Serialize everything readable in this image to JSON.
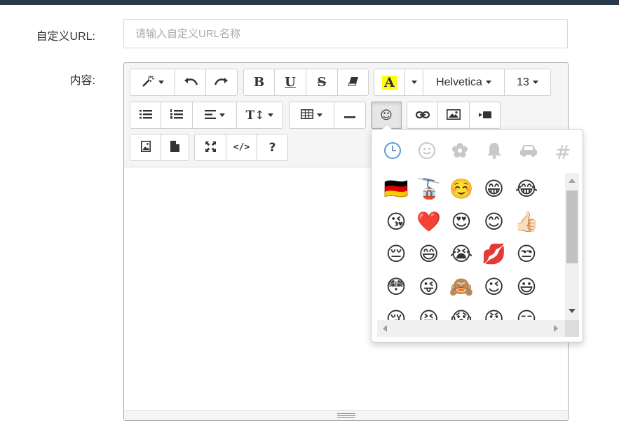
{
  "form": {
    "url_label": "自定义URL:",
    "url_placeholder": "请输入自定义URL名称",
    "url_value": "",
    "content_label": "内容:"
  },
  "toolbar": {
    "font_name": "Helvetica",
    "font_size": "13",
    "icons": [
      "magic-wand-icon",
      "undo-icon",
      "redo-icon",
      "bold-icon",
      "underline-icon",
      "strikethrough-icon",
      "eraser-icon",
      "font-color-icon",
      "color-dropdown-icon",
      "font-name-dropdown",
      "font-size-dropdown",
      "unordered-list-icon",
      "ordered-list-icon",
      "align-icon",
      "line-height-icon",
      "table-icon",
      "horizontal-rule-icon",
      "emoji-icon",
      "link-icon",
      "picture-icon",
      "video-icon",
      "image-upload-icon",
      "file-icon",
      "fullscreen-icon",
      "code-view-icon",
      "help-icon"
    ],
    "bold_glyph": "B",
    "underline_glyph": "U",
    "strike_glyph": "S",
    "help_glyph": "?",
    "code_glyph": "</>",
    "font_color_glyph": "A",
    "line_height_glyph": "T↕",
    "emoji_glyph": "☺"
  },
  "emoji_popup": {
    "categories": [
      "recent-clock-icon",
      "smiley-icon",
      "flower-icon",
      "bell-icon",
      "car-icon",
      "hash-icon"
    ],
    "active_category": "recent-clock-icon",
    "hash_glyph": "#",
    "rows": [
      [
        "🇩🇪",
        "🚡",
        "☺️",
        "😁",
        "😂"
      ],
      [
        "😘",
        "❤️",
        "😍",
        "😊",
        "👍🏻"
      ],
      [
        "😔",
        "😄",
        "😭",
        "💋",
        "😒"
      ],
      [
        "😳",
        "😜",
        "🙈",
        "😉",
        "😃"
      ],
      [
        "😢",
        "😝",
        "😱",
        "😡",
        "😏"
      ]
    ]
  },
  "colors": {
    "topbar": "#2b3a4a",
    "accent_blue": "#5b9bd5",
    "font_color_highlight": "#ffff00"
  }
}
